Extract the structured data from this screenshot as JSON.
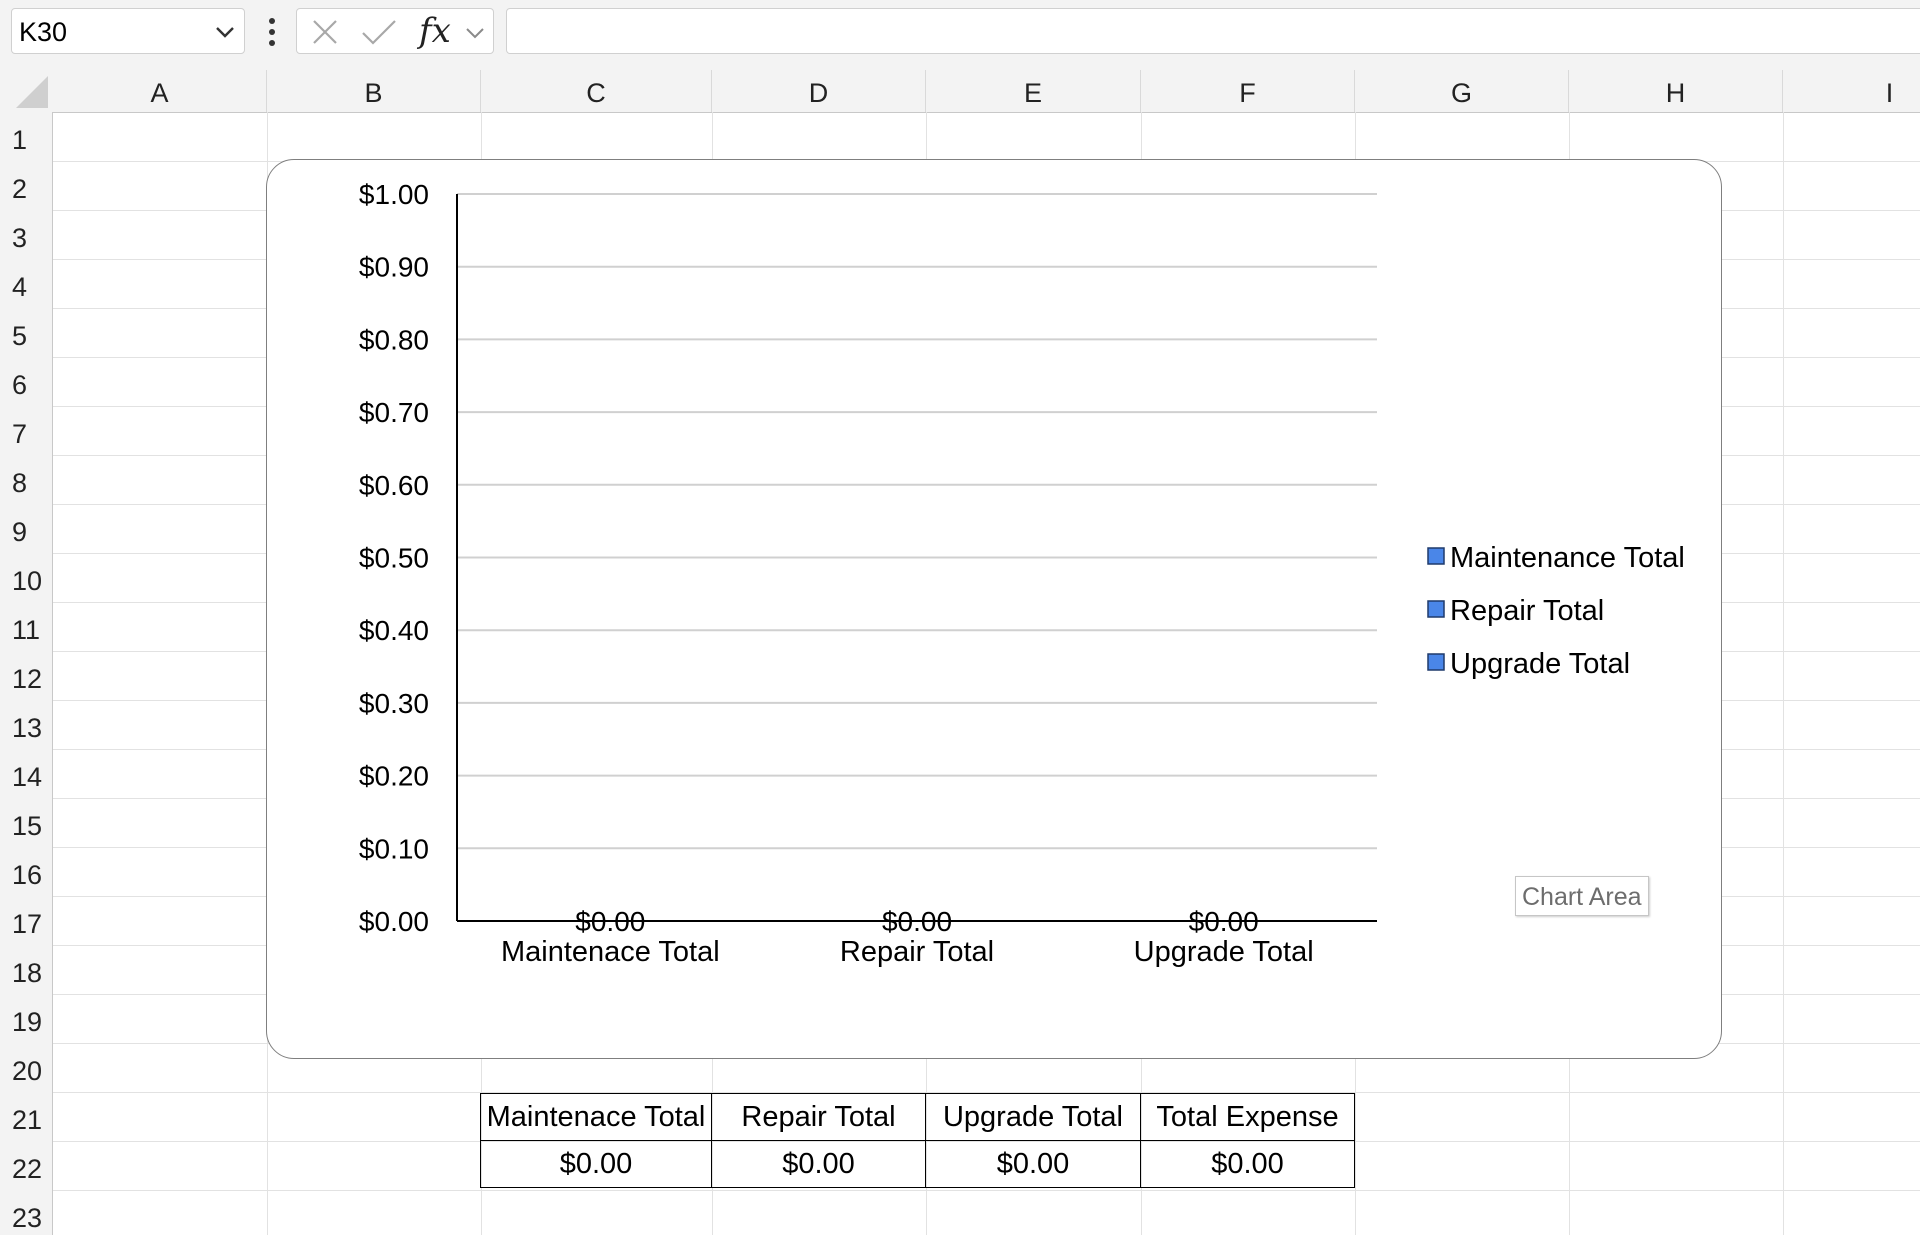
{
  "formula_bar": {
    "name_box": "K30",
    "fx_label": "fx",
    "formula": "",
    "icons": [
      "chevron-down-icon",
      "more-dots-icon",
      "cancel-icon",
      "check-icon",
      "fx-icon"
    ]
  },
  "columns": [
    "A",
    "B",
    "C",
    "D",
    "E",
    "F",
    "G",
    "H",
    "I"
  ],
  "rows": [
    "1",
    "2",
    "3",
    "4",
    "5",
    "6",
    "7",
    "8",
    "9",
    "10",
    "11",
    "12",
    "13",
    "14",
    "15",
    "16",
    "17",
    "18",
    "19",
    "20",
    "21",
    "22",
    "23"
  ],
  "chart_data": {
    "type": "bar",
    "categories": [
      "Maintenace Total",
      "Repair Total",
      "Upgrade Total"
    ],
    "series": [
      {
        "name": "",
        "values": [
          0,
          0,
          0
        ]
      }
    ],
    "data_labels": [
      "$0.00",
      "$0.00",
      "$0.00"
    ],
    "y_ticks": [
      "$0.00",
      "$0.10",
      "$0.20",
      "$0.30",
      "$0.40",
      "$0.50",
      "$0.60",
      "$0.70",
      "$0.80",
      "$0.90",
      "$1.00"
    ],
    "ylim": [
      0,
      1
    ],
    "legend": [
      "Maintenance Total",
      "Repair Total",
      "Upgrade Total"
    ],
    "legend_position": "right",
    "grid": true,
    "bar_color": "#4a86e8",
    "title": "",
    "xlabel": "",
    "ylabel": ""
  },
  "chart_tooltip": "Chart Area",
  "summary_table": {
    "headers": [
      "Maintenace Total",
      "Repair Total",
      "Upgrade Total",
      "Total Expense"
    ],
    "values": [
      "$0.00",
      "$0.00",
      "$0.00",
      "$0.00"
    ]
  }
}
